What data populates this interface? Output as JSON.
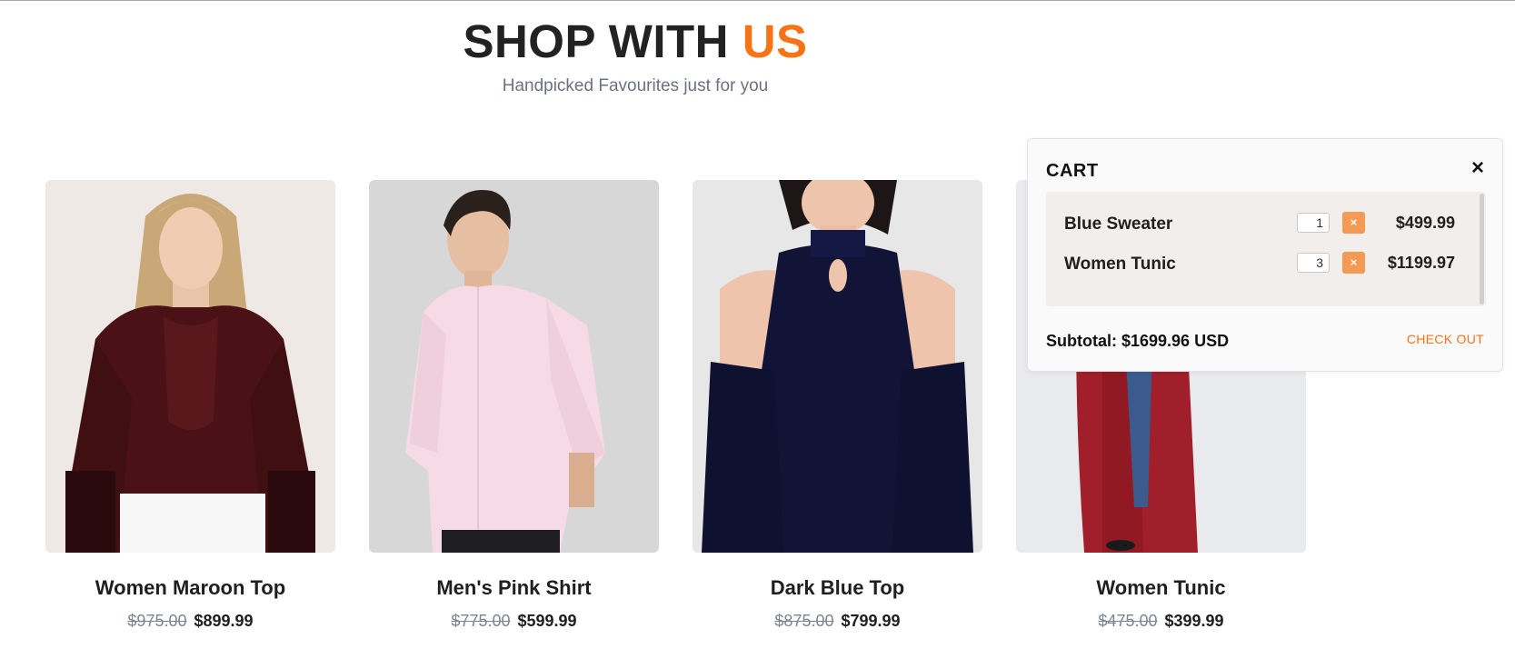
{
  "header": {
    "title_main": "SHOP WITH ",
    "title_accent": "US",
    "subtitle": "Handpicked Favourites just for you"
  },
  "products": [
    {
      "name": "Women Maroon Top",
      "old_price": "$975.00",
      "price": "$899.99"
    },
    {
      "name": "Men's Pink Shirt",
      "old_price": "$775.00",
      "price": "$599.99"
    },
    {
      "name": "Dark Blue Top",
      "old_price": "$875.00",
      "price": "$799.99"
    },
    {
      "name": "Women Tunic",
      "old_price": "$475.00",
      "price": "$399.99"
    }
  ],
  "cart": {
    "title": "CART",
    "close_icon": "×",
    "items": [
      {
        "name": "Blue Sweater",
        "qty": "1",
        "remove_icon": "×",
        "total": "$499.99"
      },
      {
        "name": "Women Tunic",
        "qty": "3",
        "remove_icon": "×",
        "total": "$1199.97"
      }
    ],
    "subtotal": "Subtotal: $1699.96 USD",
    "checkout_label": "CHECK OUT"
  },
  "colors": {
    "accent": "#f97316",
    "remove_button": "#f59a54"
  }
}
